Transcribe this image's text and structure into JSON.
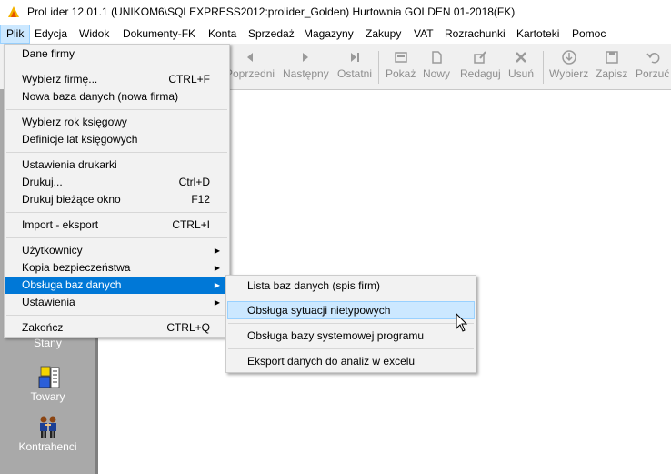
{
  "window": {
    "title": "ProLider 12.01.1  (UNIKOM6\\SQLEXPRESS2012:prolider_Golden) Hurtownia GOLDEN 01-2018(FK)",
    "app_icon": "prolider-logo-icon"
  },
  "menubar": {
    "items": [
      "Plik",
      "Edycja",
      "Widok",
      "Dokumenty-FK",
      "Konta",
      "Sprzedaż",
      "Magazyny",
      "Zakupy",
      "VAT",
      "Rozrachunki",
      "Kartoteki",
      "Pomoc"
    ],
    "active": "Plik"
  },
  "toolbar": {
    "buttons": [
      {
        "label": "Poprzedni",
        "icon": "arrow-left-icon"
      },
      {
        "label": "Następny",
        "icon": "arrow-right-icon"
      },
      {
        "label": "Ostatni",
        "icon": "arrow-last-icon"
      },
      {
        "label": "Pokaż",
        "icon": "show-icon"
      },
      {
        "label": "Nowy",
        "icon": "new-document-icon"
      },
      {
        "label": "Redaguj",
        "icon": "edit-icon"
      },
      {
        "label": "Usuń",
        "icon": "delete-icon"
      },
      {
        "label": "Wybierz",
        "icon": "select-icon"
      },
      {
        "label": "Zapisz",
        "icon": "save-icon"
      },
      {
        "label": "Porzuć",
        "icon": "undo-icon"
      }
    ]
  },
  "sidebar": {
    "items": [
      {
        "label": "Stany",
        "icon": "stock-icon"
      },
      {
        "label": "Towary",
        "icon": "goods-icon"
      },
      {
        "label": "Kontrahenci",
        "icon": "contractors-icon"
      }
    ]
  },
  "file_menu": {
    "items": [
      {
        "label": "Dane firmy",
        "shortcut": ""
      },
      {
        "label": "Wybierz firmę...",
        "shortcut": "CTRL+F"
      },
      {
        "label": "Nowa baza danych (nowa firma)",
        "shortcut": ""
      },
      {
        "label": "Wybierz rok księgowy",
        "shortcut": ""
      },
      {
        "label": "Definicje lat księgowych",
        "shortcut": ""
      },
      {
        "label": "Ustawienia drukarki",
        "shortcut": ""
      },
      {
        "label": "Drukuj...",
        "shortcut": "Ctrl+D"
      },
      {
        "label": "Drukuj bieżące okno",
        "shortcut": "F12"
      },
      {
        "label": "Import - eksport",
        "shortcut": "CTRL+I"
      },
      {
        "label": "Użytkownicy",
        "shortcut": ""
      },
      {
        "label": "Kopia bezpieczeństwa",
        "shortcut": ""
      },
      {
        "label": "Obsługa baz danych",
        "shortcut": ""
      },
      {
        "label": "Ustawienia",
        "shortcut": ""
      },
      {
        "label": "Zakończ",
        "shortcut": "CTRL+Q"
      }
    ],
    "highlighted": "Obsługa baz danych"
  },
  "submenu": {
    "items": [
      {
        "label": "Lista baz danych (spis firm)"
      },
      {
        "label": "Obsługa sytuacji nietypowych"
      },
      {
        "label": "Obsługa bazy systemowej  programu"
      },
      {
        "label": "Eksport danych do analiz w excelu"
      }
    ],
    "highlighted": "Obsługa sytuacji nietypowych"
  },
  "colors": {
    "highlight": "#0078d7",
    "hover": "#cce8ff",
    "sidebar_bg": "#a9a9a9",
    "toolbar_bg": "#f0f0f0"
  }
}
